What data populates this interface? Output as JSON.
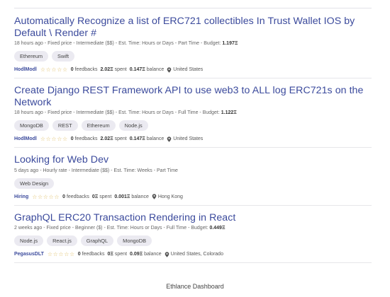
{
  "jobs": [
    {
      "title": "Automatically Recognize a list of ERC721 collectibles In Trust Wallet IOS by Default \\ Render #",
      "meta_prefix": "18 hours ago - Fixed price - Intermediate ($$) - Est. Time: Hours or Days - Part Time - Budget:",
      "budget": "1.197Ξ",
      "tags": [
        "Ethereum",
        "Swift"
      ],
      "client": "HodlModl",
      "feedbacks_value": "0",
      "feedbacks_label": "feedbacks",
      "spent_value": "2.02Ξ",
      "spent_label": "spent",
      "balance_value": "0.147Ξ",
      "balance_label": "balance",
      "location": "United States"
    },
    {
      "title": "Create Django REST Framework API to use web3 to ALL log ERC721s on the Network",
      "meta_prefix": "18 hours ago - Fixed price - Intermediate ($$) - Est. Time: Hours or Days - Full Time - Budget:",
      "budget": "1.122Ξ",
      "tags": [
        "MongoDB",
        "REST",
        "Ethereum",
        "Node.js"
      ],
      "client": "HodlModl",
      "feedbacks_value": "0",
      "feedbacks_label": "feedbacks",
      "spent_value": "2.02Ξ",
      "spent_label": "spent",
      "balance_value": "0.147Ξ",
      "balance_label": "balance",
      "location": "United States"
    },
    {
      "title": "Looking for Web Dev",
      "meta_prefix": "5 days ago - Hourly rate - Intermediate ($$) - Est. Time: Weeks - Part Time",
      "budget": "",
      "tags": [
        "Web Design"
      ],
      "client": "Hiring",
      "feedbacks_value": "0",
      "feedbacks_label": "feedbacks",
      "spent_value": "0Ξ",
      "spent_label": "spent",
      "balance_value": "0.001Ξ",
      "balance_label": "balance",
      "location": "Hong Kong"
    },
    {
      "title": "GraphQL ERC20 Transaction Rendering in React",
      "meta_prefix": "2 weeks ago - Fixed price - Beginner ($) - Est. Time: Hours or Days - Full Time - Budget:",
      "budget": "0.449Ξ",
      "tags": [
        "Node.js",
        "React.js",
        "GraphQL",
        "MongoDB"
      ],
      "client": "PegasusDLT",
      "feedbacks_value": "0",
      "feedbacks_label": "feedbacks",
      "spent_value": "0Ξ",
      "spent_label": "spent",
      "balance_value": "0.09Ξ",
      "balance_label": "balance",
      "location": "United States, Colorado"
    }
  ],
  "stars_glyph": "☆☆☆☆☆",
  "icons": {
    "star": "star-outline-icon",
    "location": "location-pin-icon"
  },
  "colors": {
    "title": "#3b4a9c",
    "star": "#e0c06a",
    "tag_bg": "#ebeaf1"
  },
  "footer": {
    "caption": "Ethlance Dashboard"
  }
}
